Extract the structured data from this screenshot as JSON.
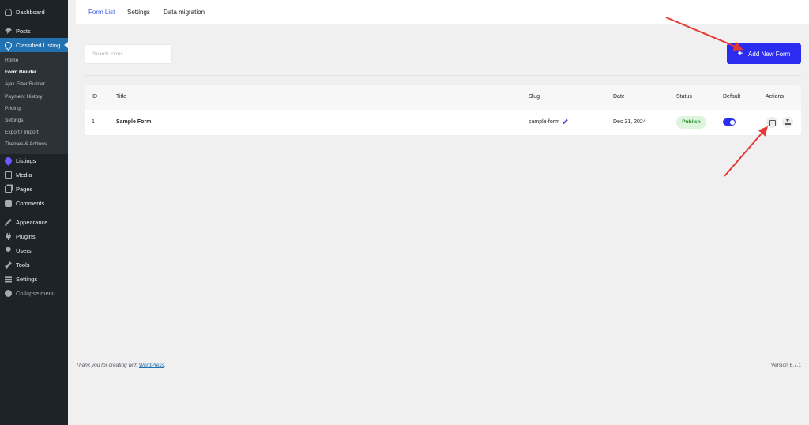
{
  "sidebar": {
    "top_items": [
      {
        "label": "Dashboard",
        "icon": "dashboard-icon"
      },
      {
        "label": "Posts",
        "icon": "pin-icon"
      },
      {
        "label": "Classified Listing",
        "icon": "map-marker-icon"
      }
    ],
    "submenu": [
      "Home",
      "Form Builder",
      "Ajax Filter Builder",
      "Payment History",
      "Pricing",
      "Settings",
      "Export / Import",
      "Themes & Addons"
    ],
    "current_submenu": "Form Builder",
    "lower_items": [
      {
        "label": "Listings",
        "icon": "map-marker-icon"
      },
      {
        "label": "Media",
        "icon": "media-icon"
      },
      {
        "label": "Pages",
        "icon": "pages-icon"
      },
      {
        "label": "Comments",
        "icon": "comment-icon"
      },
      {
        "label": "Appearance",
        "icon": "brush-icon"
      },
      {
        "label": "Plugins",
        "icon": "plugin-icon"
      },
      {
        "label": "Users",
        "icon": "users-icon"
      },
      {
        "label": "Tools",
        "icon": "tools-icon"
      },
      {
        "label": "Settings",
        "icon": "settings-icon"
      },
      {
        "label": "Collapse menu",
        "icon": "collapse-icon"
      }
    ],
    "active_color": "#2271b1",
    "bg_color": "#1d2327"
  },
  "tabs": [
    {
      "label": "Form List",
      "active": true
    },
    {
      "label": "Settings",
      "active": false
    },
    {
      "label": "Data migration",
      "active": false
    }
  ],
  "search": {
    "placeholder": "Search forms..."
  },
  "add_button": {
    "label": "Add New Form",
    "color": "#2c2cf0"
  },
  "table": {
    "headers": {
      "id": "ID",
      "title": "Title",
      "slug": "Slug",
      "date": "Date",
      "status": "Status",
      "default": "Default",
      "actions": "Actions"
    },
    "rows": [
      {
        "id": "1",
        "title": "Sample Form",
        "slug": "sample-form",
        "date": "Dec 31, 2024",
        "status": "Publish",
        "default_on": true
      }
    ]
  },
  "footer": {
    "thanks_prefix": "Thank you for creating with ",
    "thanks_link": "WordPress",
    "thanks_suffix": ".",
    "version": "Version 6.7.1"
  },
  "annotation_color": "#e53935"
}
